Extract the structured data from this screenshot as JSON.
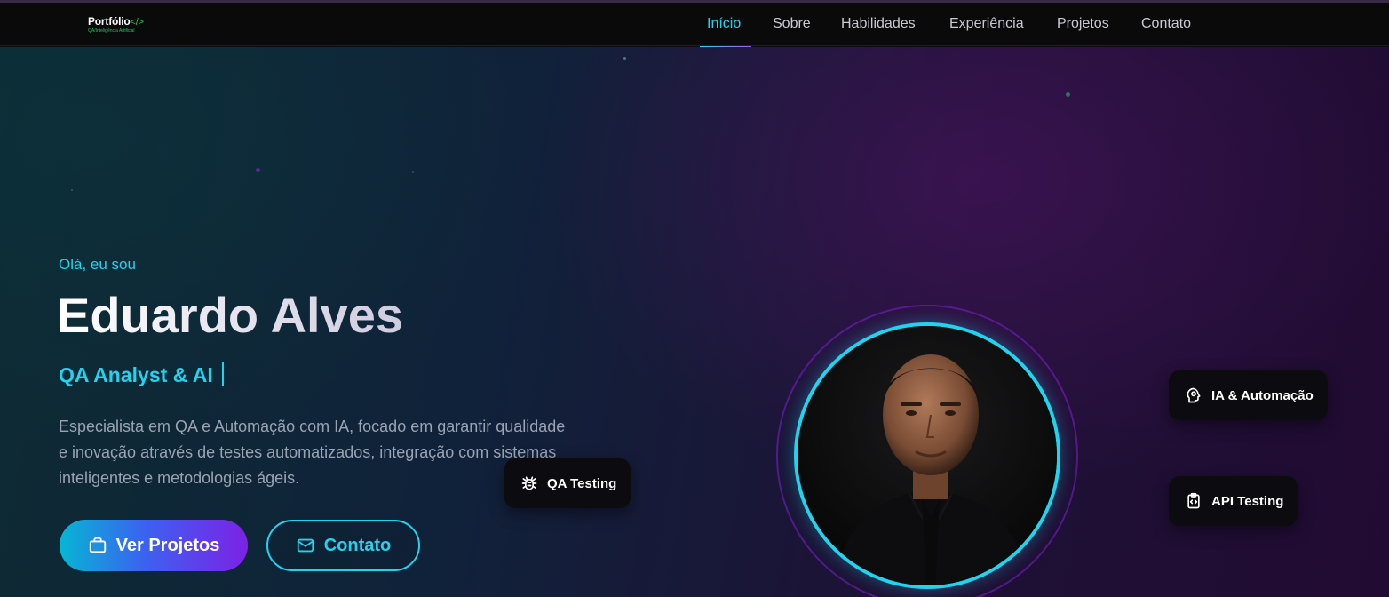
{
  "brand": {
    "title": "Portfólio",
    "code": "</>",
    "subtitle": "QA/Inteligência Artificial"
  },
  "nav": {
    "items": [
      {
        "label": "Início",
        "active": true
      },
      {
        "label": "Sobre",
        "active": false
      },
      {
        "label": "Habilidades",
        "active": false
      },
      {
        "label": "Experiência",
        "active": false
      },
      {
        "label": "Projetos",
        "active": false
      },
      {
        "label": "Contato",
        "active": false
      }
    ]
  },
  "hero": {
    "greeting": "Olá, eu sou",
    "name": "Eduardo Alves",
    "role": "QA Analyst & AI",
    "description": "Especialista em QA e Automação com IA, focado em garantir qualidade e inovação através de testes automatizados, integração com sistemas inteligentes e metodologias ágeis.",
    "primary_button": {
      "label": "Ver Projetos",
      "icon": "briefcase-icon"
    },
    "secondary_button": {
      "label": "Contato",
      "icon": "mail-icon"
    }
  },
  "badges": [
    {
      "label": "QA Testing",
      "icon": "bug-icon"
    },
    {
      "label": "IA & Automação",
      "icon": "ai-head-icon"
    },
    {
      "label": "API Testing",
      "icon": "code-clipboard-icon"
    }
  ],
  "colors": {
    "accent": "#22d3ee",
    "purple": "#7c22e6",
    "brand_green": "#22c55e",
    "navbar_bg": "#0a0a0a",
    "badge_bg": "#0c0c10"
  }
}
